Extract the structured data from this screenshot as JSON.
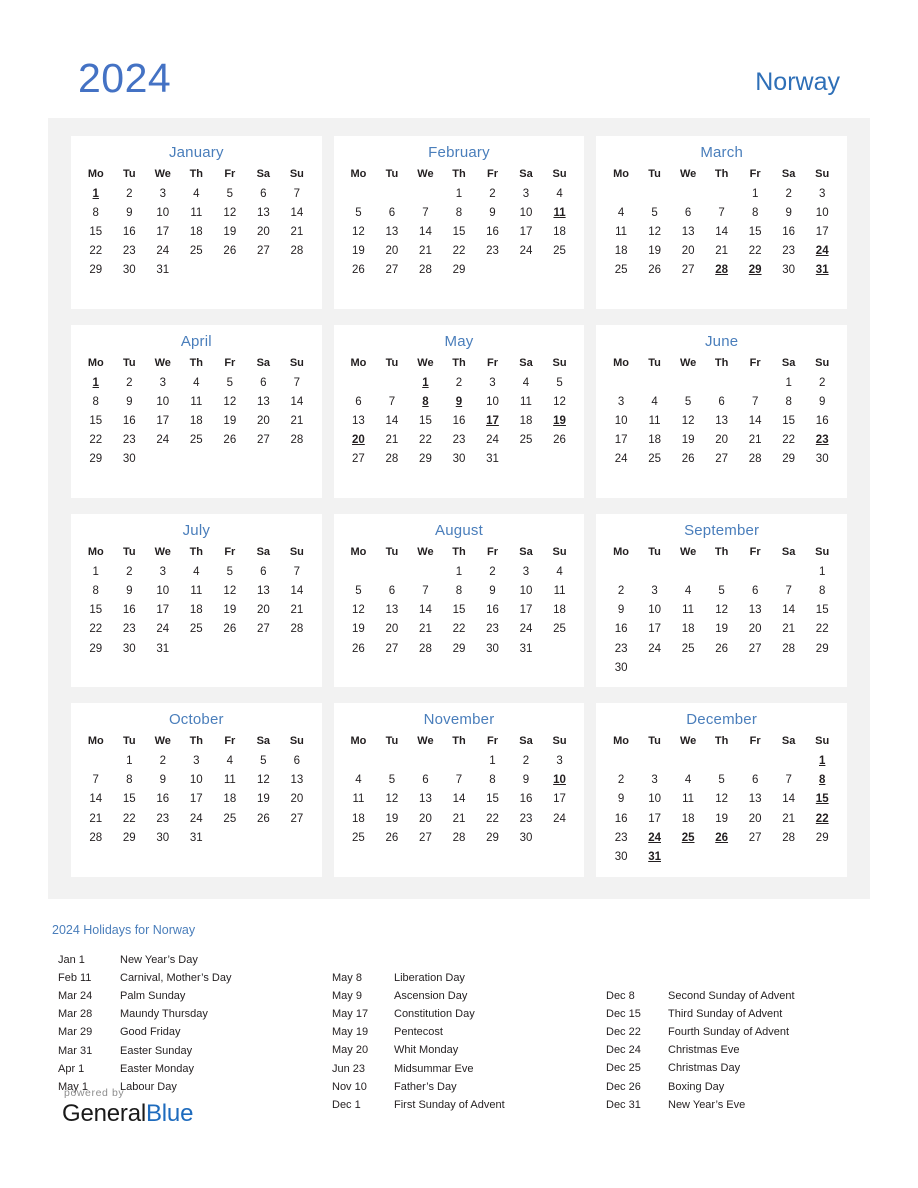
{
  "header": {
    "year": "2024",
    "country": "Norway"
  },
  "weekday_headers": [
    "Mo",
    "Tu",
    "We",
    "Th",
    "Fr",
    "Sa",
    "Su"
  ],
  "colors": {
    "accent_blue": "#4a7ebb",
    "title_blue": "#4472c4",
    "holiday_red": "#e8112d",
    "panel_gray": "#f2f2f2",
    "brand_blue": "#1e6bbd"
  },
  "months": [
    {
      "name": "January",
      "lead_blanks": 0,
      "days": 31,
      "holidays": [
        1
      ]
    },
    {
      "name": "February",
      "lead_blanks": 3,
      "days": 29,
      "holidays": [
        11
      ]
    },
    {
      "name": "March",
      "lead_blanks": 4,
      "days": 31,
      "holidays": [
        24,
        28,
        29,
        31
      ]
    },
    {
      "name": "April",
      "lead_blanks": 0,
      "days": 30,
      "holidays": [
        1
      ]
    },
    {
      "name": "May",
      "lead_blanks": 2,
      "days": 31,
      "holidays": [
        1,
        8,
        9,
        17,
        19,
        20
      ]
    },
    {
      "name": "June",
      "lead_blanks": 5,
      "days": 30,
      "holidays": [
        23
      ]
    },
    {
      "name": "July",
      "lead_blanks": 0,
      "days": 31,
      "holidays": []
    },
    {
      "name": "August",
      "lead_blanks": 3,
      "days": 31,
      "holidays": []
    },
    {
      "name": "September",
      "lead_blanks": 6,
      "days": 30,
      "holidays": []
    },
    {
      "name": "October",
      "lead_blanks": 1,
      "days": 31,
      "holidays": []
    },
    {
      "name": "November",
      "lead_blanks": 4,
      "days": 30,
      "holidays": [
        10
      ]
    },
    {
      "name": "December",
      "lead_blanks": 6,
      "days": 31,
      "holidays": [
        1,
        8,
        15,
        22,
        24,
        25,
        26,
        31
      ]
    }
  ],
  "holidays_section": {
    "title": "2024 Holidays for Norway",
    "columns": [
      [
        {
          "date": "Jan 1",
          "name": "New Year’s Day"
        },
        {
          "date": "Feb 11",
          "name": "Carnival, Mother’s Day"
        },
        {
          "date": "Mar 24",
          "name": "Palm Sunday"
        },
        {
          "date": "Mar 28",
          "name": "Maundy Thursday"
        },
        {
          "date": "Mar 29",
          "name": "Good Friday"
        },
        {
          "date": "Mar 31",
          "name": "Easter Sunday"
        },
        {
          "date": "Apr 1",
          "name": "Easter Monday"
        },
        {
          "date": "May 1",
          "name": "Labour Day"
        }
      ],
      [
        {
          "date": "May 8",
          "name": "Liberation Day"
        },
        {
          "date": "May 9",
          "name": "Ascension Day"
        },
        {
          "date": "May 17",
          "name": "Constitution Day"
        },
        {
          "date": "May 19",
          "name": "Pentecost"
        },
        {
          "date": "May 20",
          "name": "Whit Monday"
        },
        {
          "date": "Jun 23",
          "name": "Midsummar Eve"
        },
        {
          "date": "Nov 10",
          "name": "Father’s Day"
        },
        {
          "date": "Dec 1",
          "name": "First Sunday of Advent"
        }
      ],
      [
        {
          "date": "Dec 8",
          "name": "Second Sunday of Advent"
        },
        {
          "date": "Dec 15",
          "name": "Third Sunday of Advent"
        },
        {
          "date": "Dec 22",
          "name": "Fourth Sunday of Advent"
        },
        {
          "date": "Dec 24",
          "name": "Christmas Eve"
        },
        {
          "date": "Dec 25",
          "name": "Christmas Day"
        },
        {
          "date": "Dec 26",
          "name": "Boxing Day"
        },
        {
          "date": "Dec 31",
          "name": "New Year’s Eve"
        }
      ]
    ]
  },
  "footer": {
    "powered_by": "powered by",
    "brand_first": "General",
    "brand_second": "Blue"
  }
}
